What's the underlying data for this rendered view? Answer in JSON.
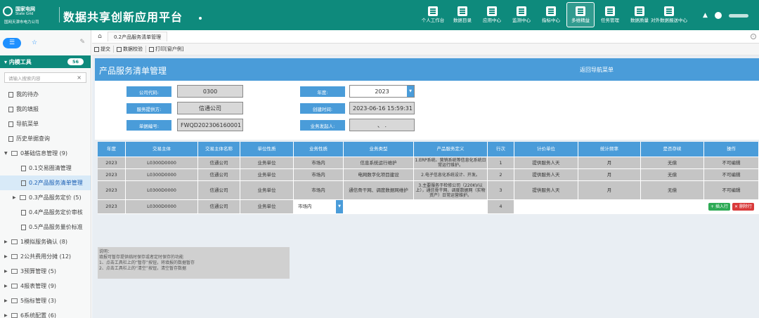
{
  "header": {
    "logo_cn": "国家电网",
    "logo_en": "State Grid",
    "logo_sub": "国网天津市电力公司",
    "app_title": "数据共享创新应用平台",
    "nav": [
      {
        "label": "个人工作台",
        "icon": "desk-icon"
      },
      {
        "label": "数据目录",
        "icon": "catalog-icon"
      },
      {
        "label": "应用中心",
        "icon": "app-icon"
      },
      {
        "label": "监测中心",
        "icon": "monitor-icon"
      },
      {
        "label": "指标中心",
        "icon": "indicator-icon"
      },
      {
        "label": "多维精益",
        "icon": "multi-dim-icon",
        "active": true
      },
      {
        "label": "任务管理",
        "icon": "task-icon"
      },
      {
        "label": "数据质量",
        "icon": "quality-icon"
      },
      {
        "label": "对外数据报送中心",
        "icon": "report-icon"
      }
    ]
  },
  "sidebar": {
    "group_title": "内模工具",
    "group_count": "56",
    "search_placeholder": "请输入搜索内容",
    "items": [
      {
        "label": "我的待办",
        "kind": "leaf"
      },
      {
        "label": "我的填报",
        "kind": "leaf"
      },
      {
        "label": "导航菜单",
        "kind": "leaf"
      },
      {
        "label": "历史单据查询",
        "kind": "leaf"
      },
      {
        "label": "0基础信息管理 (9)",
        "kind": "parent-open"
      },
      {
        "label": "0.1交易圈清管理",
        "kind": "child"
      },
      {
        "label": "0.2产品服务清单管理",
        "kind": "child",
        "selected": true
      },
      {
        "label": "0.3产品服务定价 (5)",
        "kind": "child-parent"
      },
      {
        "label": "0.4产品服务定价审核",
        "kind": "child"
      },
      {
        "label": "0.5产品服务量价标准",
        "kind": "child"
      },
      {
        "label": "1模拟服务确认 (8)",
        "kind": "parent"
      },
      {
        "label": "2公共费用分摊 (12)",
        "kind": "parent"
      },
      {
        "label": "3预算管理 (5)",
        "kind": "parent"
      },
      {
        "label": "4报表管理 (9)",
        "kind": "parent"
      },
      {
        "label": "5指标管理 (3)",
        "kind": "parent"
      },
      {
        "label": "6系统配置 (6)",
        "kind": "parent"
      }
    ]
  },
  "tabs": {
    "active": "0.2产品服务清单管理"
  },
  "toolbar": {
    "submit": "提交",
    "verify": "数据校验",
    "print": "打印[窗户例]"
  },
  "page": {
    "title": "产品服务清单管理",
    "back_nav": "返回导航菜单",
    "form": {
      "company_code_label": "公司代码:",
      "company_code": "0300",
      "provider_label": "服务提供方:",
      "provider": "信通公司",
      "doc_no_label": "单据编号:",
      "doc_no": "FWQD202306160001",
      "year_label": "年度:",
      "year": "2023",
      "created_label": "创建时间:",
      "created": "2023-06-16 15:59:31",
      "initiator_label": "业务发起人:",
      "initiator": "、  ."
    },
    "table": {
      "headers": [
        "年度",
        "交易主体",
        "交易主体名称",
        "单位性质",
        "业务性质",
        "业务类型",
        "产品服务定义",
        "行次",
        "计价单位",
        "统计频率",
        "是否存续",
        "操作"
      ],
      "rows": [
        [
          "2023",
          "L0300D0000",
          "信通公司",
          "业务单位",
          "市场内",
          "信息系统运行维护",
          "1.ERP系统、营销系统等信息化系统日常运行维护。",
          "1",
          "提供服务人天",
          "月",
          "无偿",
          "不可编辑"
        ],
        [
          "2023",
          "L0300D0000",
          "信通公司",
          "业务单位",
          "市场内",
          "电网数字化项目建设",
          "2.电子信息化系统设计、开发。",
          "2",
          "提供服务人天",
          "月",
          "无偿",
          "不可编辑"
        ],
        [
          "2023",
          "L0300D0000",
          "信通公司",
          "业务单位",
          "市场内",
          "通信骨干网、调度数据网维护",
          "3.主要服务于检修公司（220KV以上），通信骨干网、调度数据网（实物资产）日常运营维护。",
          "3",
          "提供服务人天",
          "月",
          "无偿",
          "不可编辑"
        ]
      ],
      "edit_row": {
        "year": "2023",
        "entity": "L0300D0000",
        "entity_name": "信通公司",
        "unit_type": "业务单位",
        "biz_nature": "市场内",
        "row_no": "4"
      },
      "insert_btn": "插入行",
      "delete_btn": "删除行"
    },
    "note": {
      "title": "说明：",
      "lines": [
        "填报可暂存提供临时保存或者定时保存的功能",
        "1、点击工具栏上的“暂存”按钮，将填报的数据暂存",
        "2、点击工具栏上的“清空”按钮，清空暂存数据"
      ]
    }
  }
}
